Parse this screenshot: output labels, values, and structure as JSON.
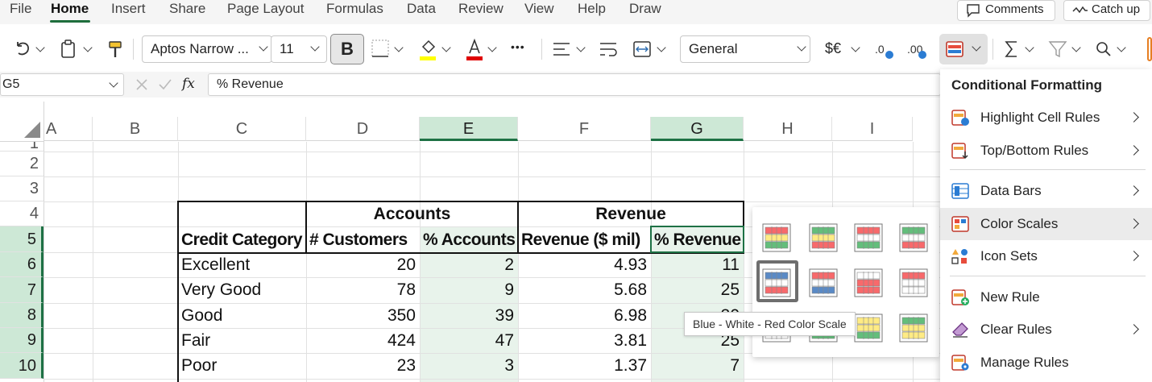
{
  "menu": {
    "tabs": [
      "File",
      "Home",
      "Insert",
      "Share",
      "Page Layout",
      "Formulas",
      "Data",
      "Review",
      "View",
      "Help",
      "Draw"
    ],
    "active": "Home",
    "comments_label": "Comments",
    "catchup_label": "Catch up"
  },
  "ribbon": {
    "font_name": "Aptos Narrow ...",
    "font_size": "11",
    "bold_label": "B",
    "number_format": "General",
    "currency_label": "$€",
    "more_label": "•••"
  },
  "formula_bar": {
    "cell_ref": "G5",
    "fx_label": "fx",
    "value": "% Revenue"
  },
  "grid": {
    "columns": [
      "A",
      "B",
      "C",
      "D",
      "E",
      "F",
      "G",
      "H",
      "I"
    ],
    "selected_columns": [
      "E",
      "G"
    ],
    "rows": [
      "1",
      "2",
      "3",
      "4",
      "5",
      "6",
      "7",
      "8",
      "9",
      "10"
    ],
    "selected_rows": [
      "5",
      "6",
      "7",
      "8",
      "9",
      "10"
    ],
    "group_headers": {
      "accounts": "Accounts",
      "revenue": "Revenue"
    },
    "headers": [
      "Credit Category",
      "# Customers",
      "% Accounts",
      "Revenue ($ mil)",
      "% Revenue"
    ],
    "data": [
      [
        "Excellent",
        "20",
        "2",
        "4.93",
        "11"
      ],
      [
        "Very Good",
        "78",
        "9",
        "5.68",
        "25"
      ],
      [
        "Good",
        "350",
        "39",
        "6.98",
        "30"
      ],
      [
        "Fair",
        "424",
        "47",
        "3.81",
        "25"
      ],
      [
        "Poor",
        "23",
        "3",
        "1.37",
        "7"
      ]
    ]
  },
  "cf_menu": {
    "title": "Conditional Formatting",
    "items": [
      {
        "label": "Highlight Cell Rules",
        "submenu": true
      },
      {
        "label": "Top/Bottom Rules",
        "submenu": true
      },
      {
        "label": "Data Bars",
        "submenu": true
      },
      {
        "label": "Color Scales",
        "submenu": true,
        "active": true
      },
      {
        "label": "Icon Sets",
        "submenu": true
      },
      {
        "label": "New Rule",
        "submenu": false
      },
      {
        "label": "Clear Rules",
        "submenu": true
      },
      {
        "label": "Manage Rules",
        "submenu": false
      }
    ]
  },
  "color_scales": {
    "tooltip": "Blue - White - Red Color Scale",
    "swatches": [
      [
        "#f8696b",
        "#ffeb84",
        "#63be7b"
      ],
      [
        "#63be7b",
        "#ffeb84",
        "#f8696b"
      ],
      [
        "#f8696b",
        "#ffffff",
        "#63be7b"
      ],
      [
        "#63be7b",
        "#ffffff",
        "#f8696b"
      ],
      [
        "#5a8ac6",
        "#ffffff",
        "#f8696b"
      ],
      [
        "#f8696b",
        "#ffffff",
        "#5a8ac6"
      ],
      [
        "#ffffff",
        "#f8696b",
        "#f8696b"
      ],
      [
        "#f8696b",
        "#ffffff",
        "#ffffff"
      ],
      [
        "#ffffff",
        "#ffffff",
        "#ffffff"
      ],
      [
        "#ffffff",
        "#63be7b",
        "#63be7b"
      ],
      [
        "#ffeb84",
        "#ffeb84",
        "#63be7b"
      ],
      [
        "#63be7b",
        "#ffeb84",
        "#ffeb84"
      ]
    ],
    "focused_index": 4
  }
}
